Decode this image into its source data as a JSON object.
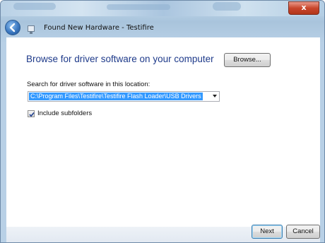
{
  "window": {
    "close_label": "x"
  },
  "header": {
    "title": "Found New Hardware - Testifire"
  },
  "main": {
    "heading": "Browse for driver software on your computer",
    "search_label": "Search for driver software in this location:",
    "path_value": "C:\\Program Files\\Testifire\\Testifire Flash Loader\\USB Drivers",
    "browse_label": "Browse...",
    "include_subfolders_label": "Include subfolders",
    "include_subfolders_checked": true
  },
  "footer": {
    "next_label": "Next",
    "cancel_label": "Cancel"
  },
  "icons": {
    "back": "back-arrow-icon",
    "dialog": "hardware-dialog-icon",
    "dropdown": "chevron-down-icon",
    "check": "checkmark-icon"
  },
  "colors": {
    "heading": "#1e3a8a",
    "selection": "#3399ff",
    "close_button": "#c9462c",
    "titlebar": "#a9c4dc"
  }
}
